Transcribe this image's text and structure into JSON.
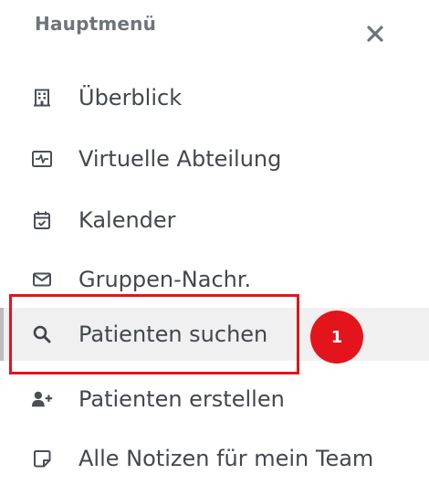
{
  "menu": {
    "title": "Hauptmenü",
    "close_icon": "close-icon",
    "items": [
      {
        "label": "Überblick",
        "icon": "building-icon"
      },
      {
        "label": "Virtuelle Abteilung",
        "icon": "monitor-pulse-icon"
      },
      {
        "label": "Kalender",
        "icon": "calendar-check-icon"
      },
      {
        "label": "Gruppen-Nachr.",
        "icon": "envelope-icon"
      },
      {
        "label": "Patienten suchen",
        "icon": "search-icon",
        "active": true
      },
      {
        "label": "Patienten erstellen",
        "icon": "user-plus-icon"
      },
      {
        "label": "Alle Notizen für mein Team",
        "icon": "note-icon"
      }
    ]
  },
  "annotation": {
    "step_number": "1",
    "highlight_color": "#e3141b"
  },
  "colors": {
    "active_background": "#f0f0f1",
    "text": "#43474e",
    "header": "#6f747b"
  }
}
